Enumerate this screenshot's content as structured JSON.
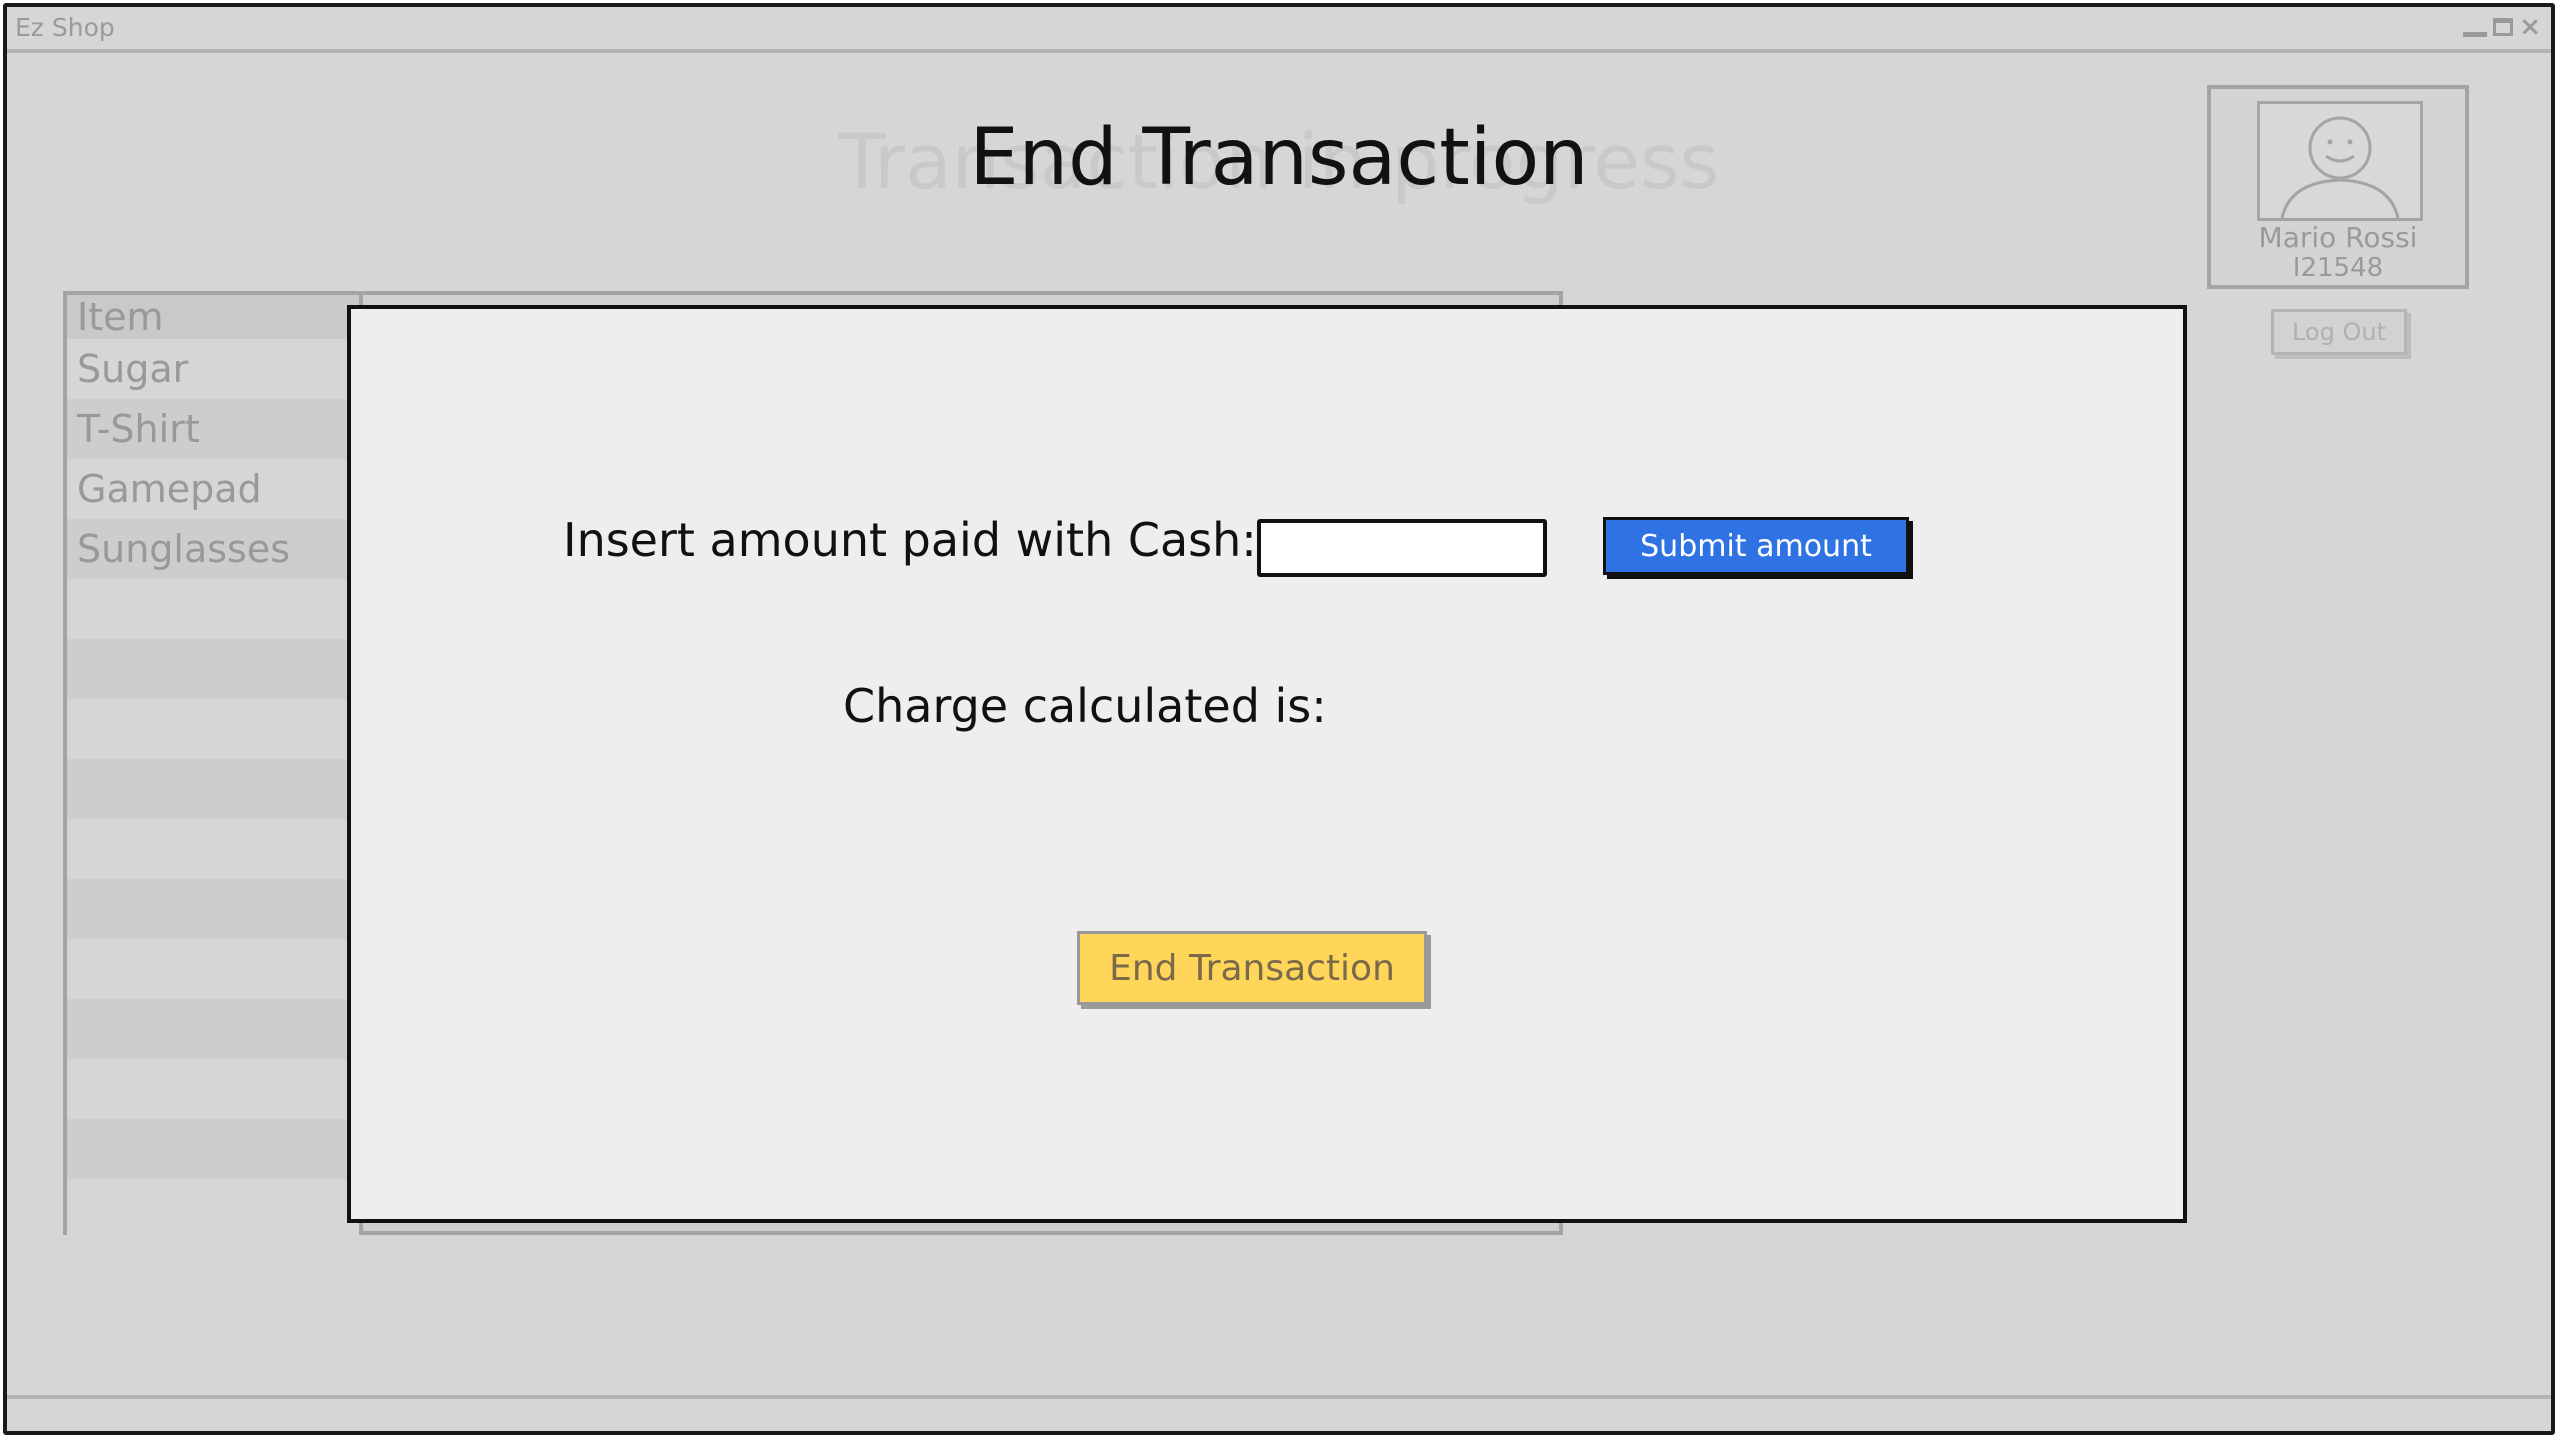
{
  "window": {
    "title": "Ez Shop",
    "controls": [
      "minimize-icon",
      "maximize-icon",
      "close-icon"
    ]
  },
  "background": {
    "page_title_ghost": "Transaction in progress",
    "table": {
      "header": "Item",
      "items": [
        "Sugar",
        "T-Shirt",
        "Gamepad",
        "Sunglasses"
      ]
    },
    "user": {
      "name": "Mario Rossi",
      "id": "I21548",
      "logout_label": "Log Out"
    }
  },
  "modal": {
    "title": "End Transaction",
    "cash_label": "Insert amount paid with Cash:",
    "cash_value": "",
    "submit_label": "Submit amount",
    "charge_label": "Charge calculated is:",
    "end_label": "End Transaction"
  },
  "colors": {
    "submit_blue": "#2f72e4",
    "end_yellow": "#ffd65a",
    "modal_bg": "#eeeeee"
  }
}
